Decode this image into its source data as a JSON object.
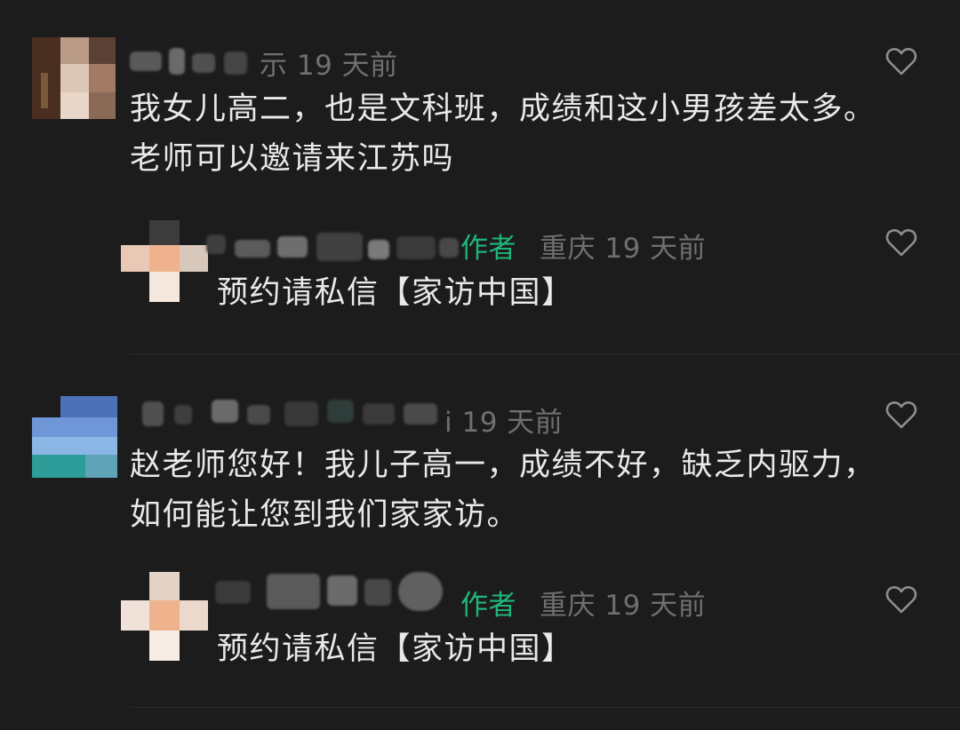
{
  "colors": {
    "background": "#1c1c1c",
    "text": "#e9e9e9",
    "meta": "#6f6f6f",
    "author_badge": "#1fb57a"
  },
  "icons": {
    "like": "heart-outline-icon"
  },
  "comments": [
    {
      "username_tail": "示",
      "time": "19 天前",
      "text": "我女儿高二，也是文科班，成绩和这小男孩差太多。老师可以邀请来江苏吗",
      "reply": {
        "badge": "作者",
        "location": "重庆",
        "time": "19 天前",
        "text": "预约请私信【家访中国】"
      }
    },
    {
      "username_tail": "i",
      "time": "19 天前",
      "text": "赵老师您好！我儿子高一，成绩不好，缺乏内驱力，如何能让您到我们家家访。",
      "reply": {
        "badge": "作者",
        "location": "重庆",
        "time": "19 天前",
        "text": "预约请私信【家访中国】"
      }
    }
  ]
}
